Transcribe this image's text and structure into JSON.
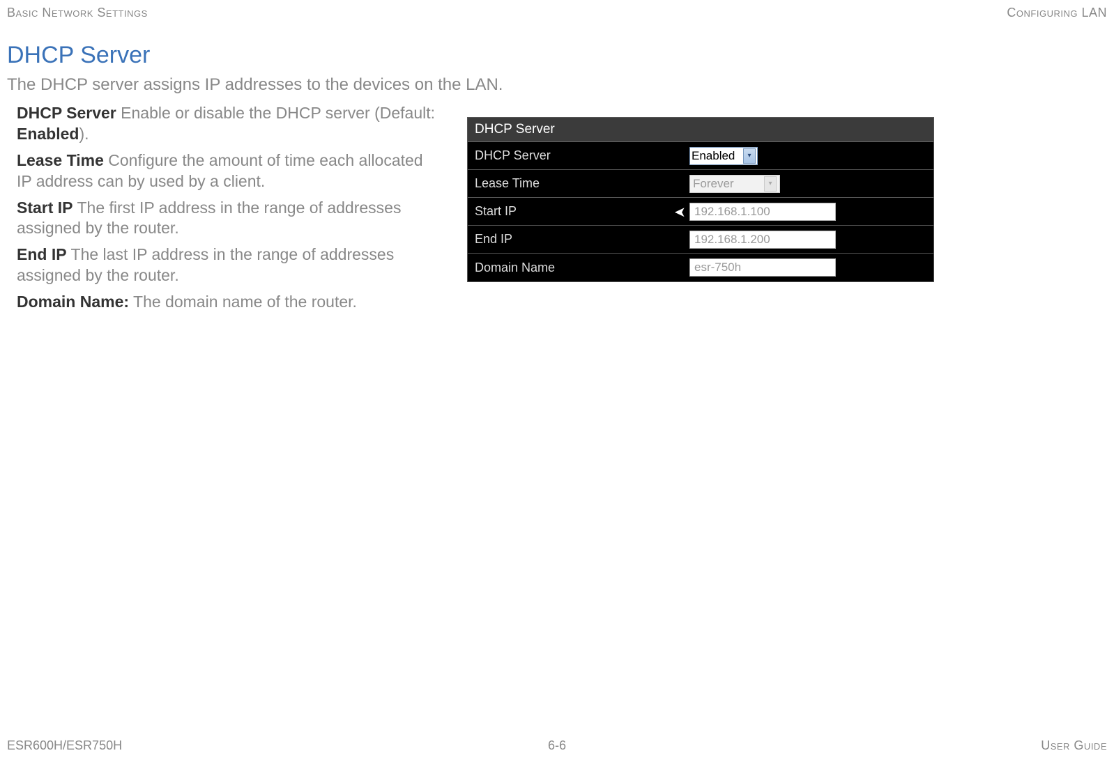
{
  "header": {
    "left": "Basic Network Settings",
    "right": "Configuring LAN"
  },
  "title": "DHCP Server",
  "subtitle": "The DHCP server assigns IP addresses to the devices on the LAN.",
  "definitions": [
    {
      "term": "DHCP Server",
      "desc_pre": "  Enable or disable the DHCP server (Default: ",
      "bold": "Enabled",
      "desc_post": ")."
    },
    {
      "term": "Lease Time",
      "desc_pre": "  Configure the amount of time each allocated IP address can by used by a client.",
      "bold": "",
      "desc_post": ""
    },
    {
      "term": "Start IP",
      "desc_pre": "  The first IP address in the range of addresses assigned by the router.",
      "bold": "",
      "desc_post": ""
    },
    {
      "term": "End IP",
      "desc_pre": "  The last IP address in the range of addresses assigned by the router.",
      "bold": "",
      "desc_post": ""
    },
    {
      "term": "Domain Name:",
      "desc_pre": " The domain name of the router.",
      "bold": "",
      "desc_post": ""
    }
  ],
  "screenshot": {
    "title": "DHCP Server",
    "rows": {
      "dhcp_server": {
        "label": "DHCP Server",
        "value": "Enabled"
      },
      "lease_time": {
        "label": "Lease Time",
        "value": "Forever"
      },
      "start_ip": {
        "label": "Start IP",
        "value": "192.168.1.100"
      },
      "end_ip": {
        "label": "End IP",
        "value": "192.168.1.200"
      },
      "domain_name": {
        "label": "Domain Name",
        "value": "esr-750h"
      }
    }
  },
  "footer": {
    "left": "ESR600H/ESR750H",
    "center": "6-6",
    "right": "User Guide"
  }
}
